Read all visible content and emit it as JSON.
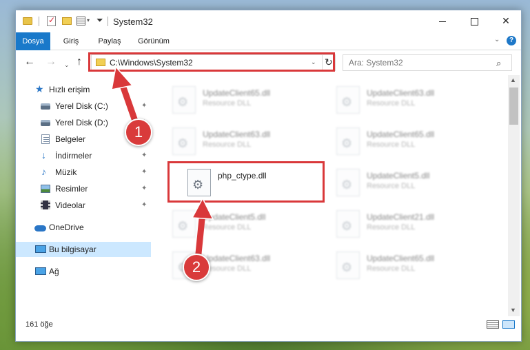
{
  "window": {
    "title": "System32",
    "quick_access": {
      "dropdown": "▾",
      "customize": "⏷"
    },
    "controls": {
      "minimize": "",
      "maximize": "",
      "close": "✕"
    }
  },
  "ribbon": {
    "tabs": [
      {
        "label": "Dosya",
        "active": true
      },
      {
        "label": "Giriş"
      },
      {
        "label": "Paylaş"
      },
      {
        "label": "Görünüm"
      }
    ],
    "expand_chevron": "⌄",
    "help": "?"
  },
  "nav": {
    "back": "←",
    "forward": "→",
    "recent": "⌄",
    "up": "↑",
    "address": "C:\\Windows\\System32",
    "address_dropdown": "⌄",
    "refresh": "↻",
    "search_placeholder": "Ara: System32",
    "search_icon": "⌕"
  },
  "sidebar": {
    "pin": "📌",
    "items": [
      {
        "label": "Hızlı erişim",
        "icon": "star-icon"
      },
      {
        "label": "Yerel Disk (C:)",
        "icon": "disk-icon",
        "pinned": true
      },
      {
        "label": "Yerel Disk (D:)",
        "icon": "disk-icon",
        "pinned": true
      },
      {
        "label": "Belgeler",
        "icon": "document-icon",
        "pinned": true
      },
      {
        "label": "İndirmeler",
        "icon": "download-icon",
        "pinned": true
      },
      {
        "label": "Müzik",
        "icon": "music-icon",
        "pinned": true
      },
      {
        "label": "Resimler",
        "icon": "pictures-icon",
        "pinned": true
      },
      {
        "label": "Videolar",
        "icon": "video-icon",
        "pinned": true
      },
      {
        "label": "OneDrive",
        "icon": "cloud-icon"
      },
      {
        "label": "Bu bilgisayar",
        "icon": "computer-icon",
        "selected": true
      },
      {
        "label": "Ağ",
        "icon": "network-icon"
      }
    ]
  },
  "files": [
    {
      "name": "UpdateClient65.dll",
      "type": "Resource DLL"
    },
    {
      "name": "UpdateClient63.dll",
      "type": "Resource DLL"
    },
    {
      "name": "UpdateClient63.dll",
      "type": "Resource DLL"
    },
    {
      "name": "UpdateClient65.dll",
      "type": "Resource DLL"
    },
    {
      "name": "php_ctype.dll",
      "type": ""
    },
    {
      "name": "UpdateClient5.dll",
      "type": "Resource DLL"
    },
    {
      "name": "UpdateClient5.dll",
      "type": "Resource DLL"
    },
    {
      "name": "UpdateClient21.dll",
      "type": "Resource DLL"
    },
    {
      "name": "UpdateClient63.dll",
      "type": "Resource DLL"
    },
    {
      "name": "UpdateClient65.dll",
      "type": "Resource DLL"
    }
  ],
  "scrollbar": {
    "up": "▲",
    "down": "▼"
  },
  "status": {
    "item_count": "161 öğe"
  },
  "annotations": {
    "step1": "1",
    "step2": "2",
    "color": "#d9383a"
  }
}
